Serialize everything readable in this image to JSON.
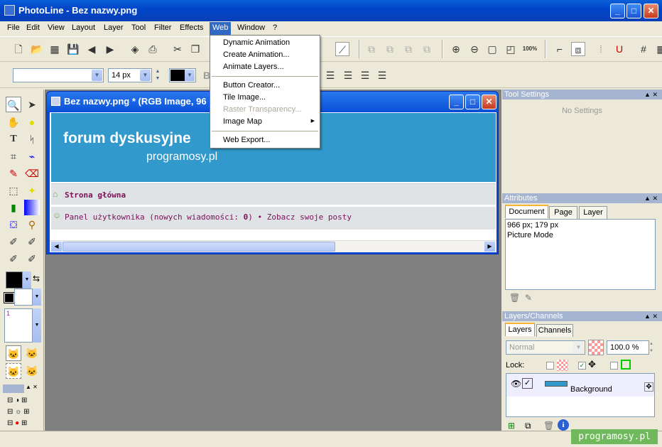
{
  "window": {
    "title": "PhotoLine - Bez nazwy.png",
    "min": "_",
    "max": "□",
    "close": "✕"
  },
  "menu": [
    "File",
    "Edit",
    "View",
    "Layout",
    "Layer",
    "Tool",
    "Filter",
    "Effects",
    "Web",
    "Window",
    "?"
  ],
  "web_menu": {
    "items": [
      {
        "label": "Dynamic Animation",
        "enabled": true
      },
      {
        "label": "Create Animation...",
        "enabled": true
      },
      {
        "label": "Animate Layers...",
        "enabled": true
      },
      {
        "label": "Button Creator...",
        "enabled": true
      },
      {
        "label": "Tile Image...",
        "enabled": true
      },
      {
        "label": "Raster Transparency...",
        "enabled": false
      },
      {
        "label": "Image Map",
        "enabled": true,
        "submenu_arrow": "▶"
      },
      {
        "label": "Web Export...",
        "enabled": true
      }
    ]
  },
  "toolbar": {
    "zoom_label": "100%"
  },
  "textbar": {
    "font_value": "",
    "size_value": "14 px",
    "bold_label": "B"
  },
  "document": {
    "title": "Bez nazwy.png * (RGB Image, 96",
    "banner_title": "forum dyskusyjne",
    "banner_subtitle": "programosy.pl",
    "nav_home": "Strona główna",
    "nav_panel": "Panel użytkownika (nowych wiadomości: ",
    "nav_count": "0",
    "nav_close": ")",
    "nav_bullet": "•",
    "nav_posts": "Zobacz swoje posty"
  },
  "tool_settings": {
    "title": "Tool Settings",
    "empty": "No Settings"
  },
  "attributes": {
    "title": "Attributes",
    "tabs": [
      "Document",
      "Page",
      "Layer"
    ],
    "line1": "966 px; 179 px",
    "line2": "Picture Mode"
  },
  "layers": {
    "title": "Layers/Channels",
    "tabs": [
      "Layers",
      "Channels"
    ],
    "blend_mode": "Normal",
    "opacity": "100.0 %",
    "lock_label": "Lock:",
    "layer_name": "Background"
  },
  "color_panel": {
    "layer_number": "1"
  },
  "watermark": "programosy.pl",
  "colors": {
    "accent": "#316ac5",
    "banner": "#3199cc",
    "link": "#7b1058"
  }
}
